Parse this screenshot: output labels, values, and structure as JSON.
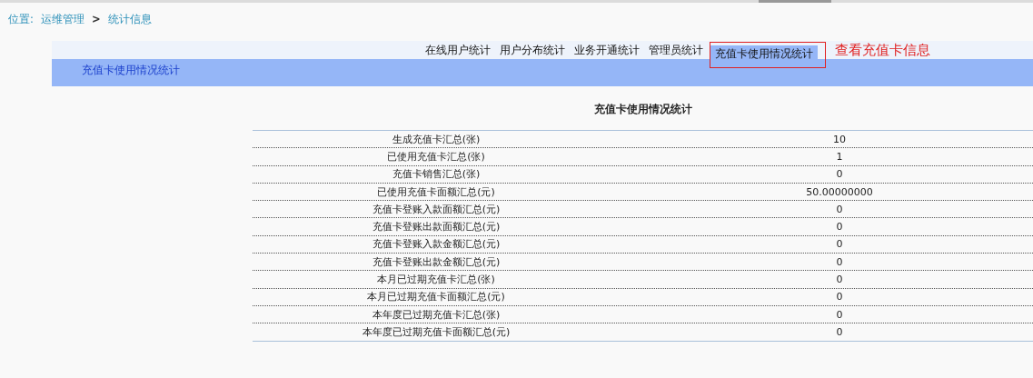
{
  "breadcrumb": {
    "label": "位置:",
    "items": [
      "运维管理",
      "统计信息"
    ],
    "separator": ">"
  },
  "tabs": [
    {
      "label": "在线用户统计",
      "selected": false
    },
    {
      "label": "用户分布统计",
      "selected": false
    },
    {
      "label": "业务开通统计",
      "selected": false
    },
    {
      "label": "管理员统计",
      "selected": false
    },
    {
      "label": "充值卡使用情况统计",
      "selected": true
    }
  ],
  "annotation": "查看充值卡信息",
  "section_title": "充值卡使用情况统计",
  "table": {
    "title": "充值卡使用情况统计",
    "rows": [
      {
        "label": "生成充值卡汇总(张)",
        "value": "10"
      },
      {
        "label": "已使用充值卡汇总(张)",
        "value": "1"
      },
      {
        "label": "充值卡销售汇总(张)",
        "value": "0"
      },
      {
        "label": "已使用充值卡面额汇总(元)",
        "value": "50.00000000"
      },
      {
        "label": "充值卡登账入款面额汇总(元)",
        "value": "0"
      },
      {
        "label": "充值卡登账出款面额汇总(元)",
        "value": "0"
      },
      {
        "label": "充值卡登账入款金额汇总(元)",
        "value": "0"
      },
      {
        "label": "充值卡登账出款金额汇总(元)",
        "value": "0"
      },
      {
        "label": "本月已过期充值卡汇总(张)",
        "value": "0"
      },
      {
        "label": "本月已过期充值卡面额汇总(元)",
        "value": "0"
      },
      {
        "label": "本年度已过期充值卡汇总(张)",
        "value": "0"
      },
      {
        "label": "本年度已过期充值卡面额汇总(元)",
        "value": "0"
      }
    ]
  }
}
